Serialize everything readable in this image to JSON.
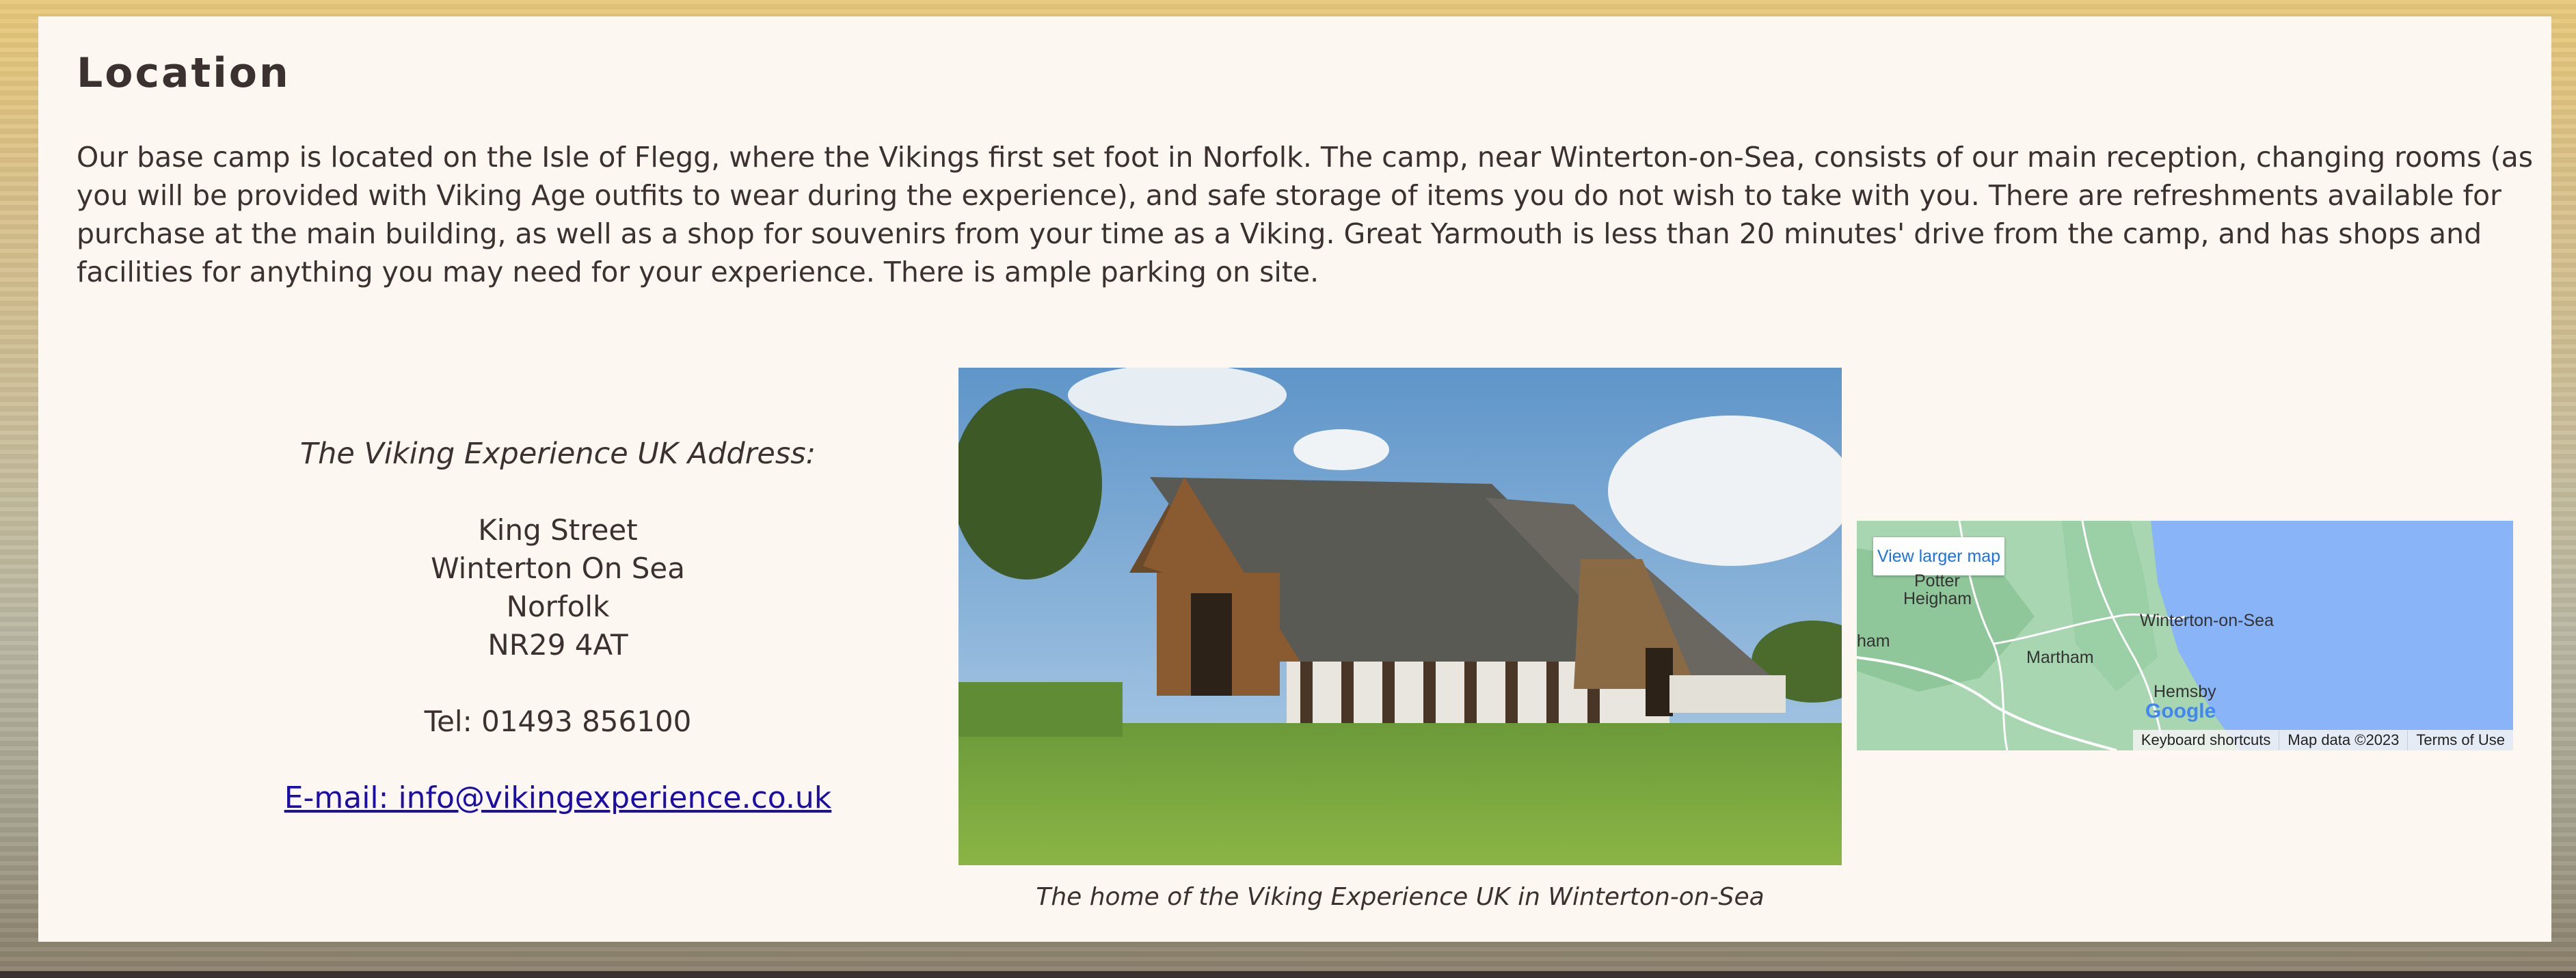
{
  "section": {
    "heading": "Location",
    "intro": "Our base camp is located on the Isle of Flegg, where the Vikings first set foot in Norfolk. The camp, near Winterton-on-Sea, consists of our main reception, changing rooms (as you will be provided with Viking Age outfits to wear during the experience), and safe storage of items you do not wish to take with you. There are refreshments available for purchase at the main building, as well as a shop for souvenirs from your time as a Viking. Great Yarmouth is less than 20 minutes' drive from the camp, and has shops and facilities for anything you may need for your experience. There is ample parking on site."
  },
  "address": {
    "title": "The Viking Experience UK Address:",
    "street": "King Street",
    "town": "Winterton On Sea",
    "county": "Norfolk",
    "postcode": "NR29 4AT",
    "tel": "Tel: 01493 856100",
    "email_link": "E-mail: info@vikingexperience.co.uk"
  },
  "photo": {
    "caption": "The home of the Viking Experience UK in Winterton-on-Sea"
  },
  "map": {
    "view_larger": "View larger map",
    "labels": {
      "potter": "Potter",
      "heigham": "Heigham",
      "ham": "ham",
      "martham": "Martham",
      "winterton": "Winterton-on-Sea",
      "hemsby": "Hemsby"
    },
    "logo": "Google",
    "footer": {
      "shortcuts": "Keyboard shortcuts",
      "map_data": "Map data ©2023",
      "terms": "Terms of Use"
    }
  },
  "colors": {
    "text": "#3b3130",
    "card": "#fdf7f1",
    "link": "#1a0dab",
    "sea": "#8ab4f8",
    "land": "#a8d6b0"
  }
}
